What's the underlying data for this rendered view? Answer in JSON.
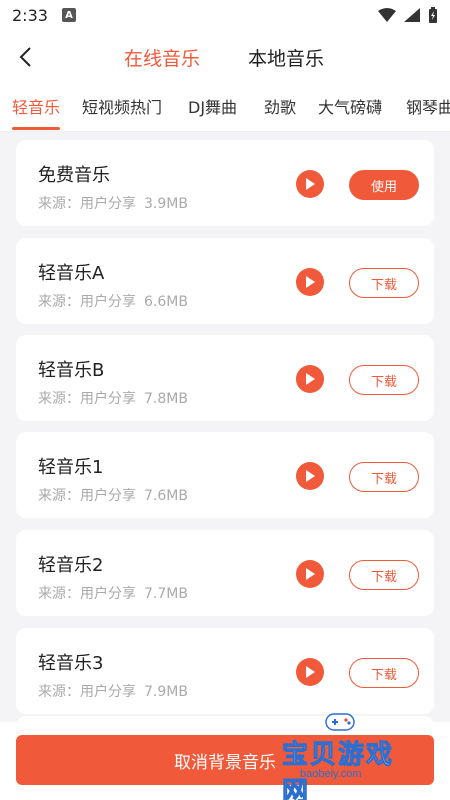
{
  "status": {
    "time": "2:33",
    "notif_icon": "A"
  },
  "header": {
    "tab_online": "在线音乐",
    "tab_local": "本地音乐"
  },
  "categories": [
    "轻音乐",
    "短视频热门",
    "DJ舞曲",
    "劲歌",
    "大气磅礴",
    "钢琴曲"
  ],
  "accent_color": "#f05a3a",
  "songs": [
    {
      "title": "免费音乐",
      "source": "来源：用户分享",
      "size": "3.9MB",
      "action": "使用"
    },
    {
      "title": "轻音乐A",
      "source": "来源：用户分享",
      "size": "6.6MB",
      "action": "下载"
    },
    {
      "title": "轻音乐B",
      "source": "来源：用户分享",
      "size": "7.8MB",
      "action": "下载"
    },
    {
      "title": "轻音乐1",
      "source": "来源：用户分享",
      "size": "7.6MB",
      "action": "下载"
    },
    {
      "title": "轻音乐2",
      "source": "来源：用户分享",
      "size": "7.7MB",
      "action": "下载"
    },
    {
      "title": "轻音乐3",
      "source": "来源：用户分享",
      "size": "7.9MB",
      "action": "下载"
    }
  ],
  "bottom": {
    "cancel_label": "取消背景音乐"
  },
  "watermark": {
    "text": "宝贝游戏网",
    "url": "baobeiy.com"
  }
}
